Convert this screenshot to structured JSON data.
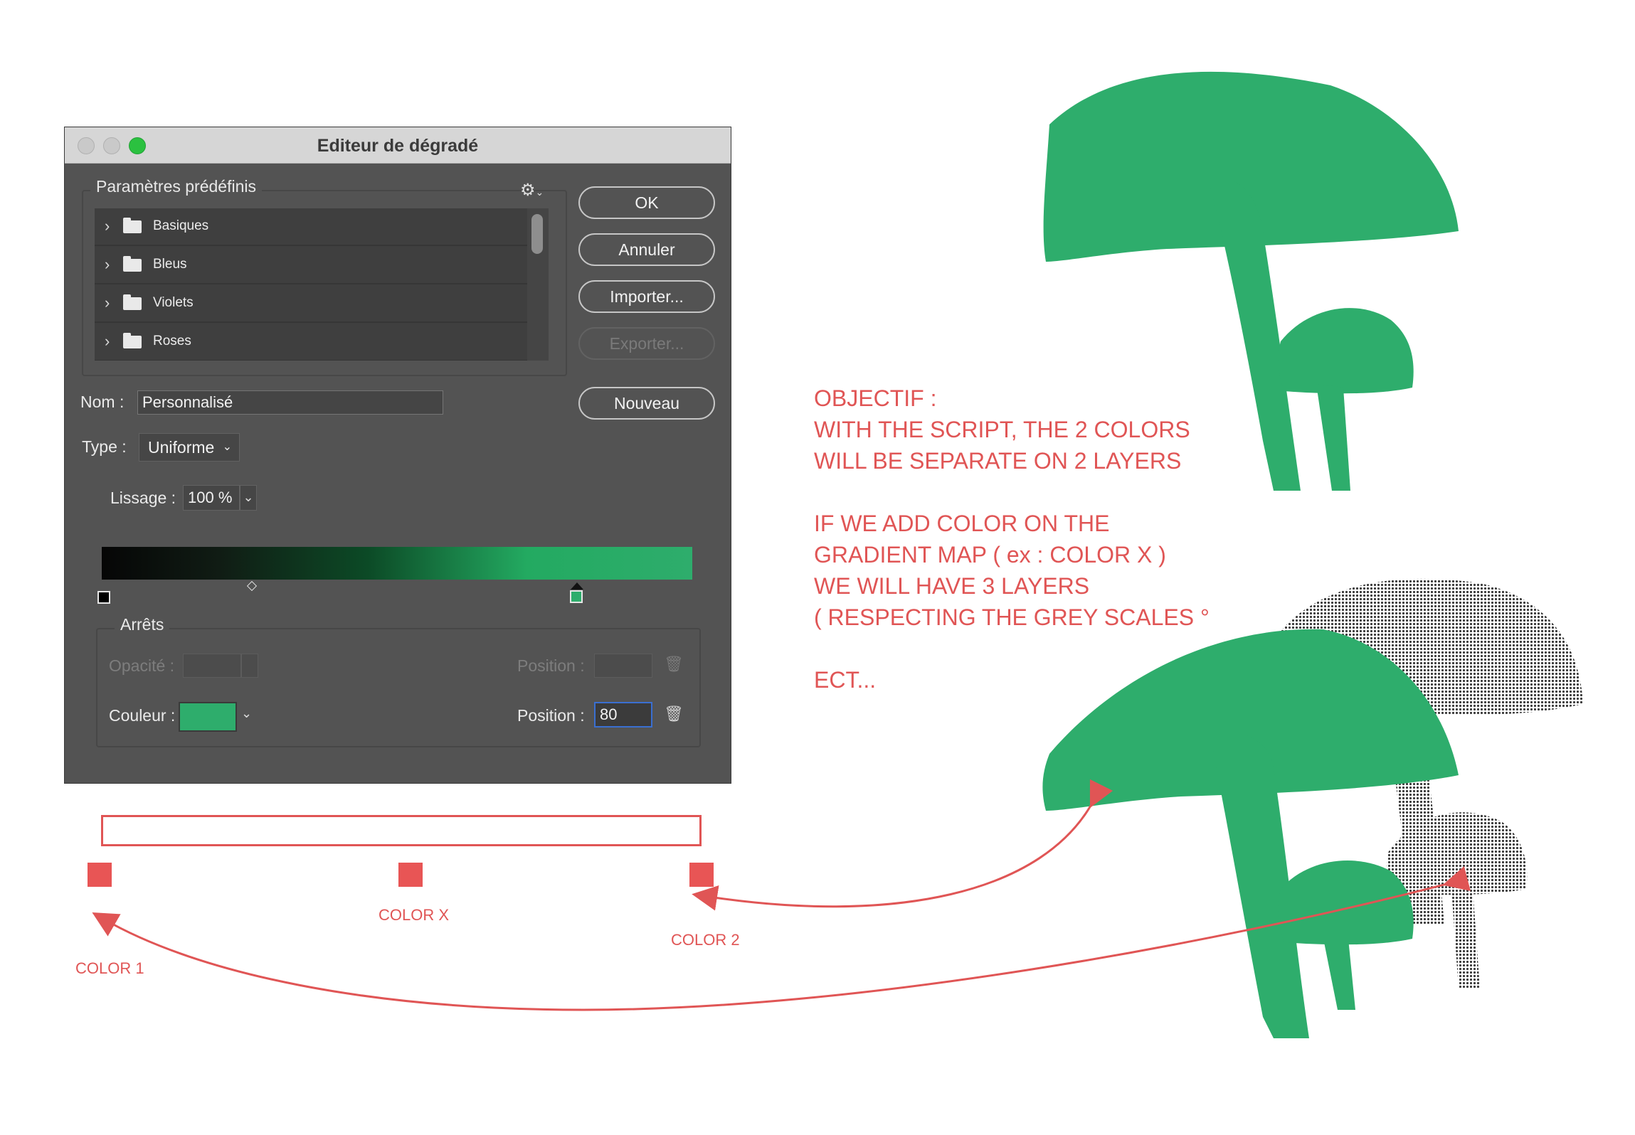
{
  "dialog": {
    "title": "Editeur de dégradé",
    "presets_legend": "Paramètres prédéfinis",
    "presets": [
      {
        "label": "Basiques"
      },
      {
        "label": "Bleus"
      },
      {
        "label": "Violets"
      },
      {
        "label": "Roses"
      }
    ],
    "buttons": {
      "ok": "OK",
      "cancel": "Annuler",
      "import": "Importer...",
      "export": "Exporter...",
      "new": "Nouveau"
    },
    "name_label": "Nom :",
    "name_value": "Personnalisé",
    "type_label": "Type :",
    "type_value": "Uniforme",
    "smoothness_label": "Lissage :",
    "smoothness_value": "100 %",
    "gradient_stops": [
      {
        "color": "#000000",
        "position": 0
      },
      {
        "color": "#2ead6c",
        "position": 80
      }
    ],
    "stops_legend": "Arrêts",
    "opacity_label": "Opacité :",
    "opacity_position_label": "Position :",
    "color_label": "Couleur :",
    "color_value": "#2ead6c",
    "color_position_label": "Position :",
    "color_position_value": "80"
  },
  "annotations": {
    "main_text": [
      "OBJECTIF :",
      "WITH THE SCRIPT, THE 2 COLORS",
      "WILL BE SEPARATE ON 2 LAYERS",
      "",
      "IF WE ADD COLOR ON THE",
      "GRADIENT MAP ( ex : COLOR X )",
      "WE WILL HAVE 3 LAYERS",
      "( RESPECTING THE GREY SCALES °",
      "",
      "ECT..."
    ],
    "color1": "COLOR 1",
    "colorx": "COLOR X",
    "color2": "COLOR 2"
  },
  "colors": {
    "accent_green": "#2ead6c",
    "annotation_red": "#e05555",
    "dialog_bg": "#535353"
  }
}
